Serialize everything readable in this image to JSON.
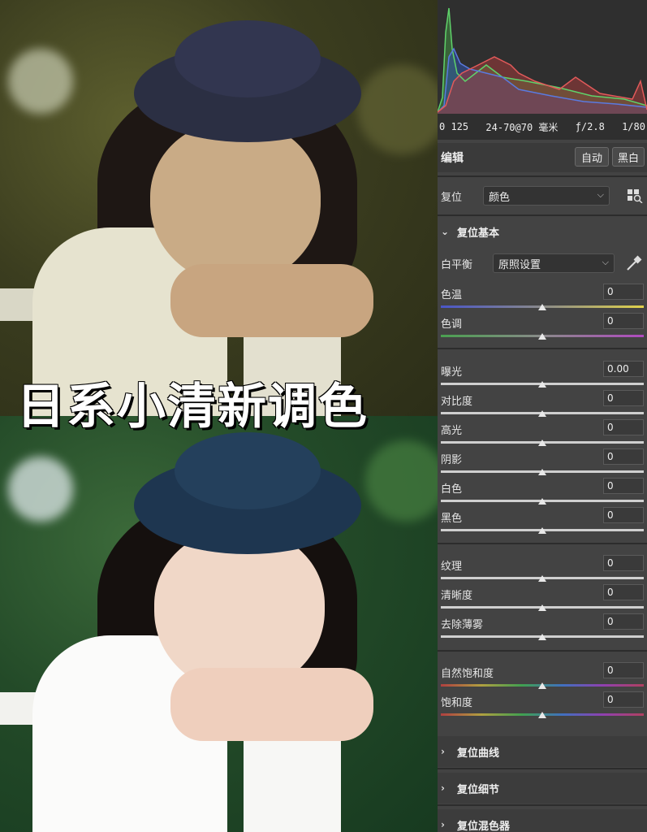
{
  "overlay": {
    "title": "日系小清新调色"
  },
  "camera_info": {
    "iso": "0 125",
    "lens": "24-70@70 毫米",
    "aperture": "ƒ/2.8",
    "shutter": "1/80"
  },
  "edit": {
    "title": "编辑",
    "auto_label": "自动",
    "bw_label": "黑白"
  },
  "profile": {
    "label": "复位",
    "value": "颜色"
  },
  "basic": {
    "title": "复位基本"
  },
  "white_balance": {
    "label": "白平衡",
    "value": "原照设置"
  },
  "sliders": {
    "temp": {
      "label": "色温",
      "value": "0"
    },
    "tint": {
      "label": "色调",
      "value": "0"
    },
    "exposure": {
      "label": "曝光",
      "value": "0.00"
    },
    "contrast": {
      "label": "对比度",
      "value": "0"
    },
    "highlights": {
      "label": "高光",
      "value": "0"
    },
    "shadows": {
      "label": "阴影",
      "value": "0"
    },
    "whites": {
      "label": "白色",
      "value": "0"
    },
    "blacks": {
      "label": "黑色",
      "value": "0"
    },
    "texture": {
      "label": "纹理",
      "value": "0"
    },
    "clarity": {
      "label": "清晰度",
      "value": "0"
    },
    "dehaze": {
      "label": "去除薄雾",
      "value": "0"
    },
    "vibrance": {
      "label": "自然饱和度",
      "value": "0"
    },
    "saturation": {
      "label": "饱和度",
      "value": "0"
    }
  },
  "sections": {
    "curve": "复位曲线",
    "detail": "复位细节",
    "mixer": "复位混色器"
  },
  "icons": {
    "collapse": "chevron-down-icon",
    "expand": "chevron-right-icon",
    "grid": "profile-browser-icon",
    "dropper": "eyedropper-icon"
  },
  "colors": {
    "panel_bg": "#434343",
    "histogram_bg": "#2f2f2f",
    "temp_gradient_start": "#4a56c8",
    "temp_gradient_end": "#e0d24a",
    "tint_gradient_start": "#4aa050",
    "tint_gradient_end": "#b04ac0"
  }
}
